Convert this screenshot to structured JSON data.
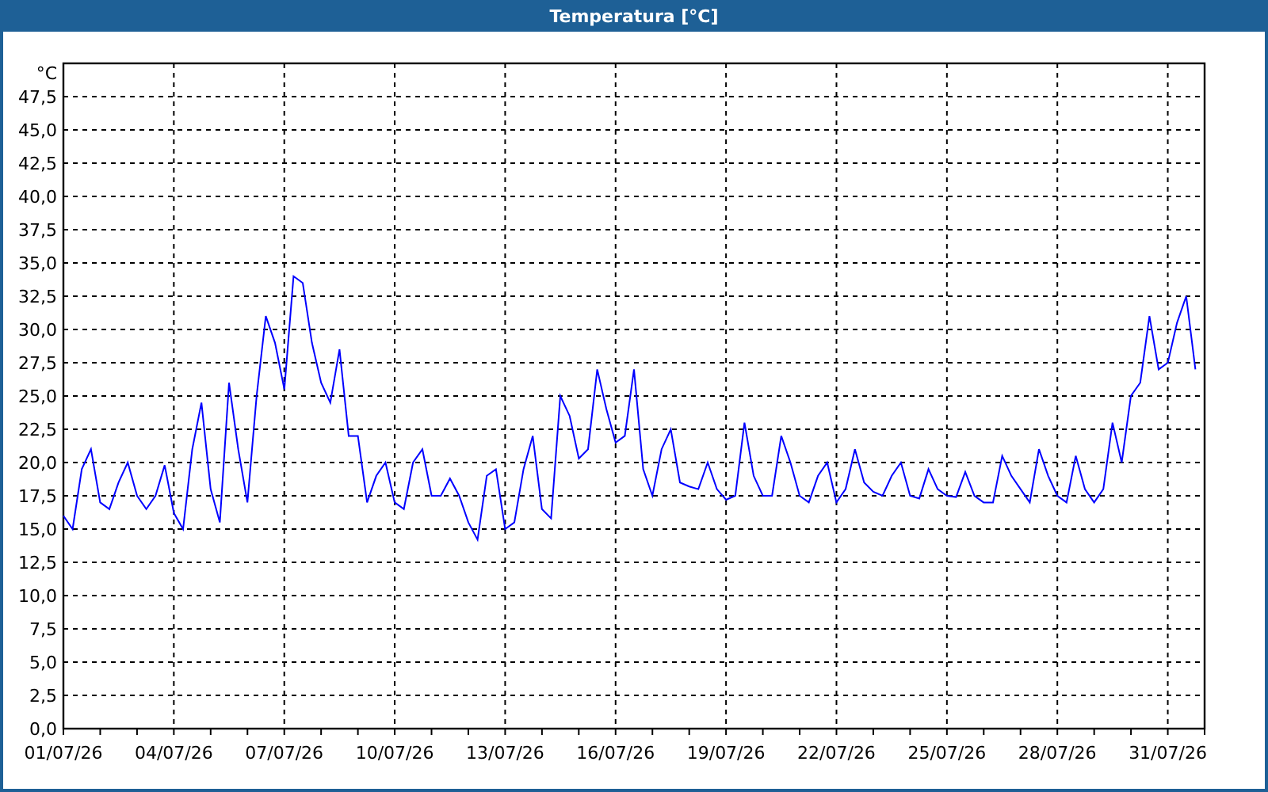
{
  "window": {
    "title": "Temperatura [°C]"
  },
  "chart": {
    "chart_data": {
      "type": "line",
      "grid": true,
      "ylabel": "°C",
      "ylim": [
        0,
        50
      ],
      "yticks": [
        {
          "value": 0,
          "label": "0,0"
        },
        {
          "value": 2.5,
          "label": "2,5"
        },
        {
          "value": 5,
          "label": "5,0"
        },
        {
          "value": 7.5,
          "label": "7,5"
        },
        {
          "value": 10,
          "label": "10,0"
        },
        {
          "value": 12.5,
          "label": "12,5"
        },
        {
          "value": 15,
          "label": "15,0"
        },
        {
          "value": 17.5,
          "label": "17,5"
        },
        {
          "value": 20,
          "label": "20,0"
        },
        {
          "value": 22.5,
          "label": "22,5"
        },
        {
          "value": 25,
          "label": "25,0"
        },
        {
          "value": 27.5,
          "label": "27,5"
        },
        {
          "value": 30,
          "label": "30,0"
        },
        {
          "value": 32.5,
          "label": "32,5"
        },
        {
          "value": 35,
          "label": "35,0"
        },
        {
          "value": 37.5,
          "label": "37,5"
        },
        {
          "value": 40,
          "label": "40,0"
        },
        {
          "value": 42.5,
          "label": "42,5"
        },
        {
          "value": 45,
          "label": "45,0"
        },
        {
          "value": 47.5,
          "label": "47,5"
        }
      ],
      "categories": [
        "01/07/26",
        null,
        null,
        null,
        null,
        null,
        null,
        null,
        null,
        null,
        null,
        null,
        "04/07/26",
        null,
        null,
        null,
        null,
        null,
        null,
        null,
        null,
        null,
        null,
        null,
        "07/07/26",
        null,
        null,
        null,
        null,
        null,
        null,
        null,
        null,
        null,
        null,
        null,
        "10/07/26",
        null,
        null,
        null,
        null,
        null,
        null,
        null,
        null,
        null,
        null,
        null,
        "13/07/26",
        null,
        null,
        null,
        null,
        null,
        null,
        null,
        null,
        null,
        null,
        null,
        "16/07/26",
        null,
        null,
        null,
        null,
        null,
        null,
        null,
        null,
        null,
        null,
        null,
        "19/07/26",
        null,
        null,
        null,
        null,
        null,
        null,
        null,
        null,
        null,
        null,
        null,
        "22/07/26",
        null,
        null,
        null,
        null,
        null,
        null,
        null,
        null,
        null,
        null,
        null,
        "25/07/26",
        null,
        null,
        null,
        null,
        null,
        null,
        null,
        null,
        null,
        null,
        null,
        "28/07/26",
        null,
        null,
        null,
        null,
        null,
        null,
        null,
        null,
        null,
        null,
        null,
        "31/07/26",
        null,
        null,
        null
      ],
      "series": [
        {
          "color": "#0000ff",
          "values": [
            16,
            15,
            19.5,
            21,
            17,
            16.5,
            18.5,
            20,
            17.5,
            16.5,
            17.5,
            19.8,
            16.2,
            15,
            21,
            24.5,
            18,
            15.5,
            26,
            21,
            17,
            25,
            31,
            29,
            25.5,
            34,
            33.5,
            29,
            26,
            24.5,
            28.5,
            22,
            22,
            17,
            19,
            20,
            17,
            16.5,
            20,
            21,
            17.5,
            17.5,
            18.8,
            17.5,
            15.5,
            14.2,
            19,
            19.5,
            15,
            15.5,
            19.5,
            22,
            16.5,
            15.8,
            25,
            23.5,
            20.3,
            21,
            27,
            24,
            21.5,
            22,
            27,
            19.5,
            17.5,
            21,
            22.5,
            18.5,
            18.2,
            18,
            20,
            18,
            17.2,
            17.5,
            23,
            19,
            17.5,
            17.5,
            22,
            20,
            17.5,
            17,
            19,
            20,
            17,
            18,
            21,
            18.5,
            17.8,
            17.5,
            19,
            20,
            17.5,
            17.3,
            19.5,
            18,
            17.5,
            17.4,
            19.3,
            17.5,
            17,
            17,
            20.5,
            19,
            18,
            17,
            21,
            19,
            17.5,
            17,
            20.5,
            18,
            17,
            18,
            23,
            20,
            25,
            26,
            31,
            27,
            27.5,
            30.5,
            32.5,
            27
          ]
        }
      ]
    }
  }
}
